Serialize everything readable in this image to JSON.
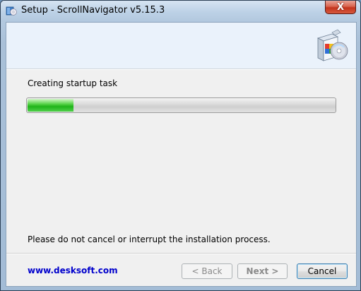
{
  "window": {
    "title": "Setup - ScrollNavigator v5.15.3",
    "close_glyph": "X",
    "icons": {
      "app": "installer-app-icon",
      "close": "close-icon",
      "header": "setup-box-cd-icon"
    }
  },
  "main": {
    "status": "Creating startup task",
    "progress": 0.15,
    "notice": "Please do not cancel or interrupt the installation process."
  },
  "footer": {
    "link": "www.desksoft.com",
    "back_label": "< Back",
    "next_label": "Next >",
    "cancel_label": "Cancel"
  },
  "colors": {
    "progress_fill": "#1fb31a",
    "link": "#0000cc",
    "header_bg": "#eaf2fb",
    "close_button": "#c3331c"
  }
}
